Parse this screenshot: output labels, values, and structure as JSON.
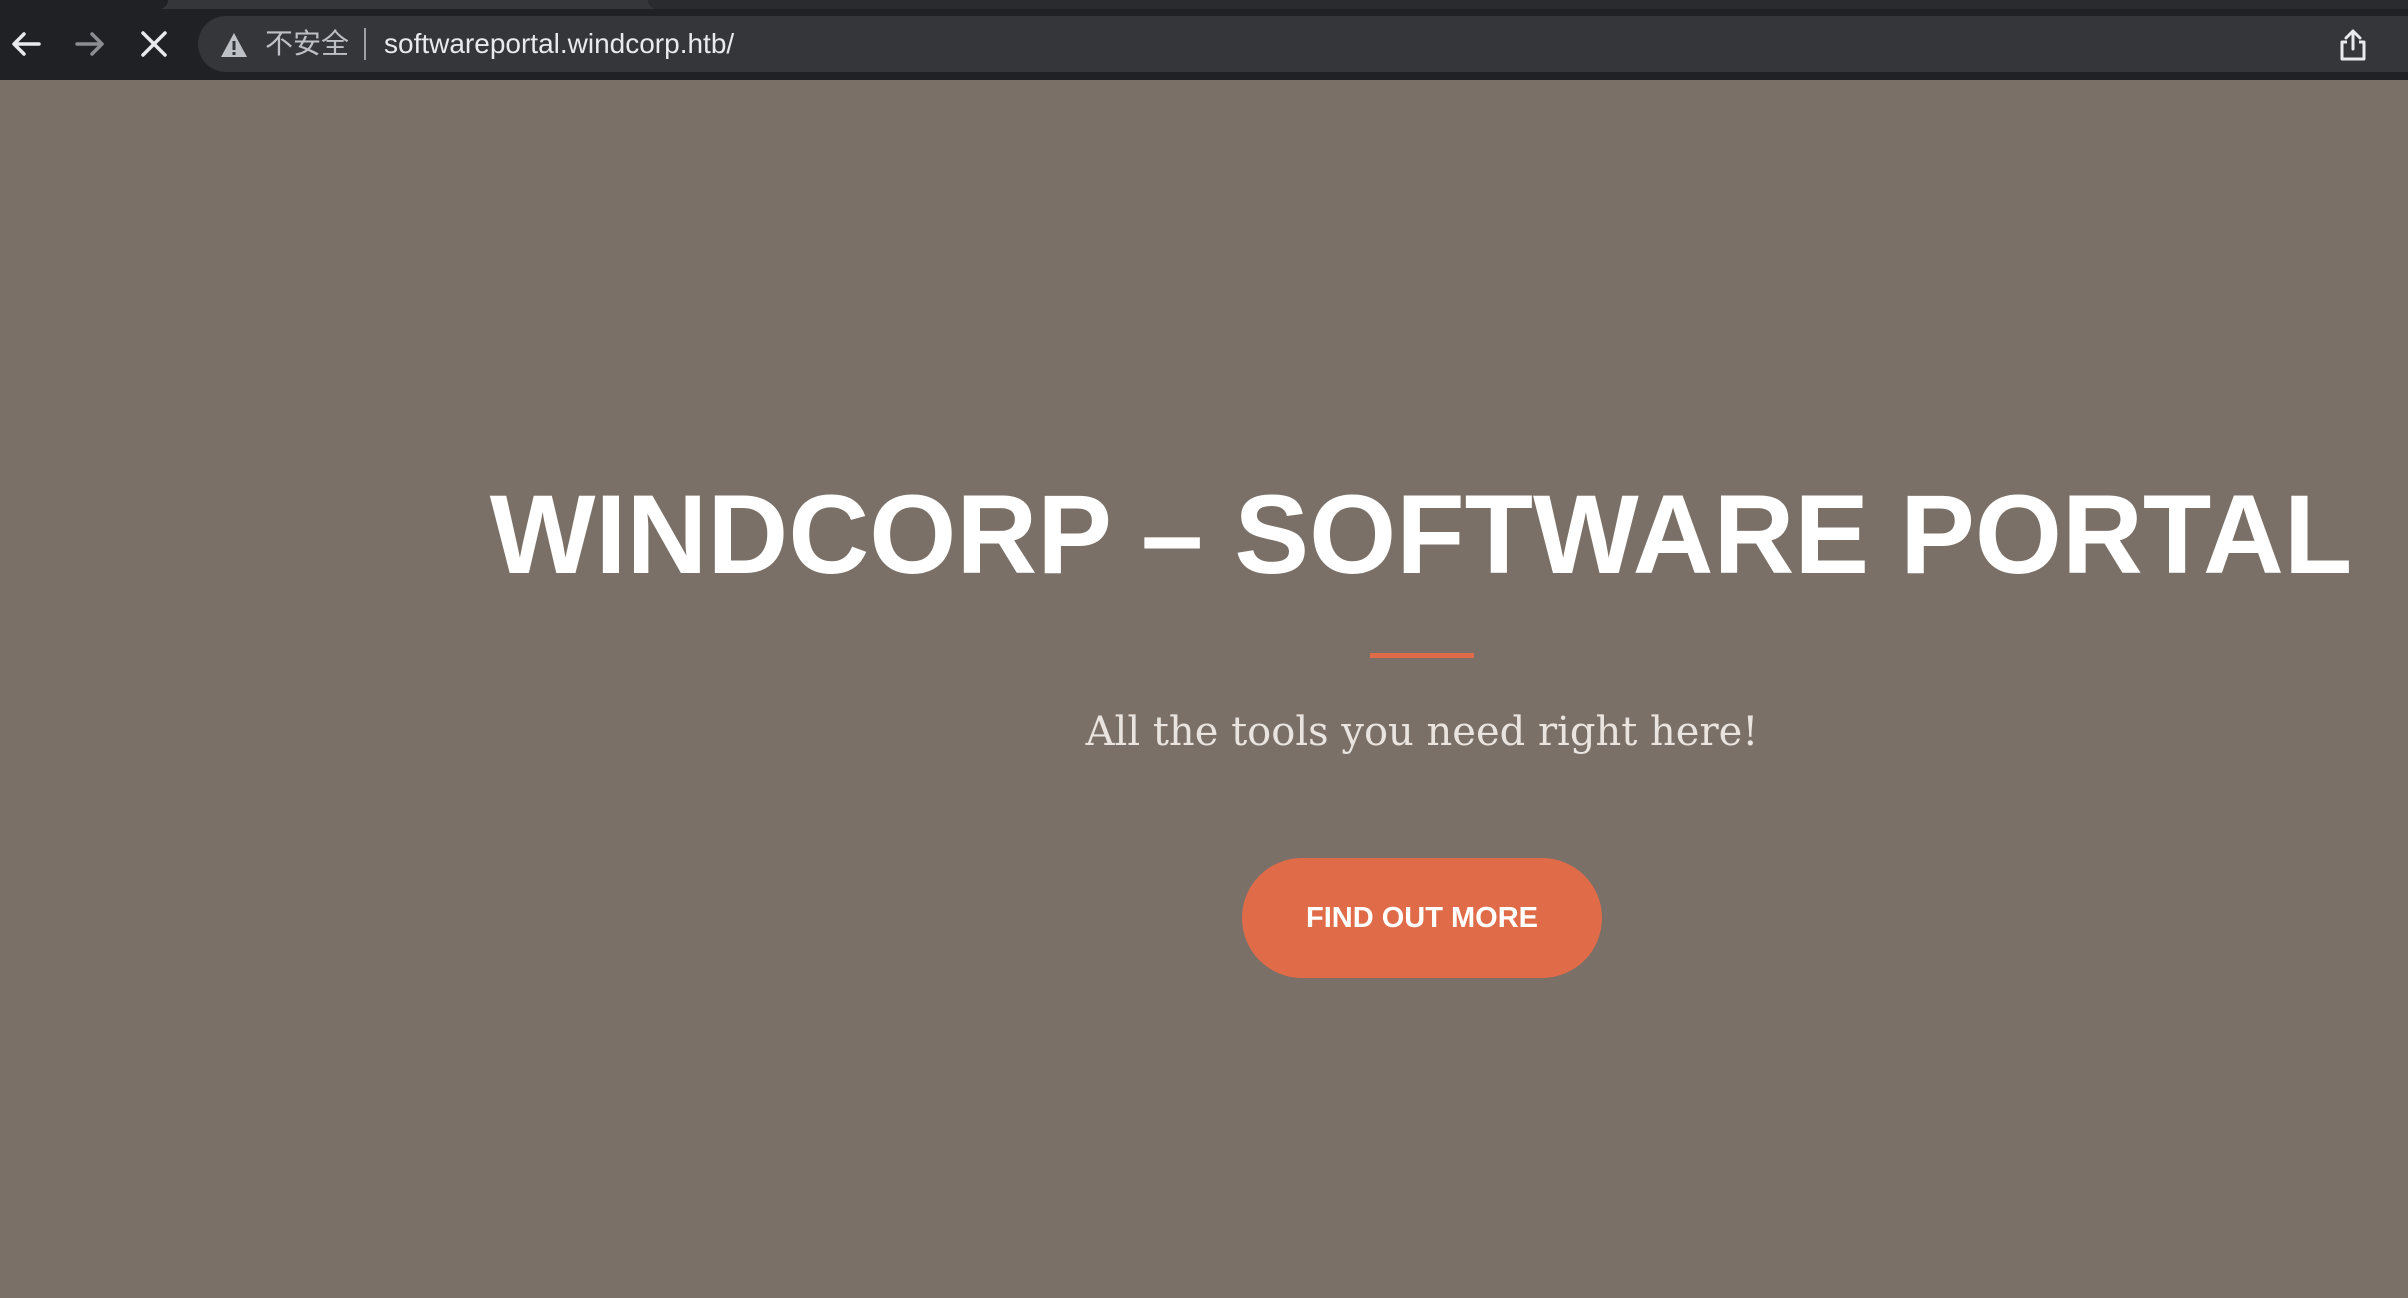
{
  "browser": {
    "security_label": "不安全",
    "url": "softwareportal.windcorp.htb/",
    "icons": {
      "back": "back-arrow-icon",
      "forward": "forward-arrow-icon",
      "stop": "stop-loading-icon",
      "warning": "warning-triangle-icon",
      "share": "share-icon"
    }
  },
  "hero": {
    "title": "WINDCORP – SOFTWARE PORTAL",
    "subtitle": "All the tools you need right here!",
    "cta_label": "FIND OUT MORE"
  },
  "colors": {
    "background": "#7b7067",
    "accent": "#e06b48",
    "title_text": "#ffffff",
    "browser_chrome": "#202124"
  }
}
